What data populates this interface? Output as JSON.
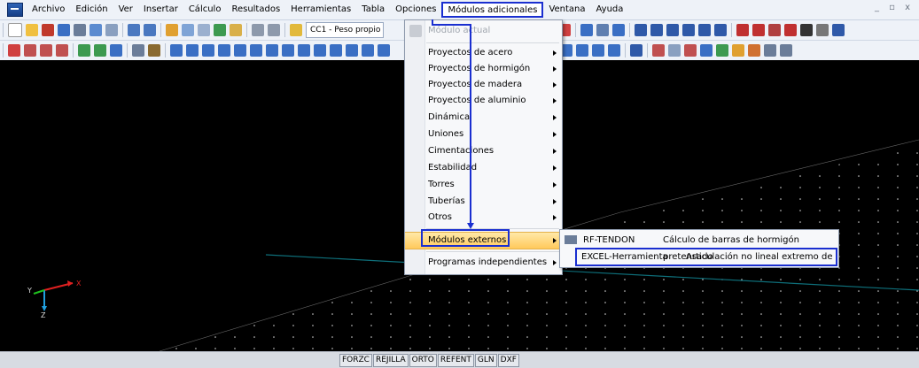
{
  "menubar": {
    "items": [
      "Archivo",
      "Edición",
      "Ver",
      "Insertar",
      "Cálculo",
      "Resultados",
      "Herramientas",
      "Tabla",
      "Opciones",
      "Módulos adicionales",
      "Ventana",
      "Ayuda"
    ],
    "window_controls": "_ ▫ x"
  },
  "toolbar": {
    "load_case": "CC1 - Peso propio"
  },
  "dropdown": {
    "current_module": "Módulo actual",
    "items": [
      "Proyectos de acero",
      "Proyectos de hormigón",
      "Proyectos de madera",
      "Proyectos de aluminio",
      "Dinámica",
      "Uniones",
      "Cimentaciones",
      "Estabilidad",
      "Torres",
      "Tuberías",
      "Otros"
    ],
    "external": "Módulos externos",
    "standalone": "Programas independientes"
  },
  "submenu": {
    "items": [
      {
        "name": "RF-TENDON",
        "desc": "Cálculo de barras de hormigón pretensado"
      },
      {
        "name": "EXCEL-Herramienta",
        "desc": "Articulación no lineal extremo de barra"
      }
    ]
  },
  "axes": {
    "x": "X",
    "y": "Y",
    "z": "Z"
  },
  "statusbar": {
    "buttons": [
      "FORZC",
      "REJILLA",
      "ORTO",
      "REFENT",
      "GLN",
      "DXF"
    ]
  },
  "colors": {
    "accent": "#1a2fd0",
    "highlight": "#ffc95c",
    "grid_line": "#0e6f7a"
  }
}
